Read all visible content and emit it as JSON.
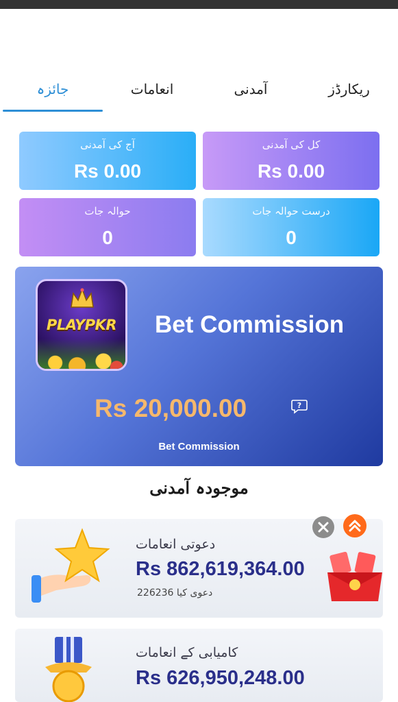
{
  "tabs": [
    {
      "label": "جائزہ",
      "active": true
    },
    {
      "label": "انعامات",
      "active": false
    },
    {
      "label": "آمدنی",
      "active": false
    },
    {
      "label": "ریکارڈز",
      "active": false
    }
  ],
  "stats": {
    "today_income": {
      "label": "آج کی آمدنی",
      "value": "Rs 0.00"
    },
    "total_income": {
      "label": "کل کی آمدنی",
      "value": "Rs 0.00"
    },
    "referrals": {
      "label": "حوالہ جات",
      "value": "0"
    },
    "valid_referrals": {
      "label": "درست حوالہ جات",
      "value": "0"
    }
  },
  "bet_commission": {
    "logo_text": "PLAYPKR",
    "title": "Bet Commission",
    "amount": "Rs 20,000.00",
    "footer": "Bet Commission"
  },
  "section_title": "موجودہ آمدنی",
  "rewards": [
    {
      "label": "دعوتی انعامات",
      "value": "Rs 862,619,364.00",
      "sub": "226236 دعوی کیا",
      "icon": "star-hand-icon",
      "side_icon": "red-envelope-icon"
    },
    {
      "label": "کامیابی کے انعامات",
      "value": "Rs 626,950,248.00",
      "icon": "medal-icon"
    }
  ],
  "colors": {
    "accent": "#2e8fd6",
    "amount_orange": "#f6b86c",
    "reward_value": "#2a2f8a"
  }
}
